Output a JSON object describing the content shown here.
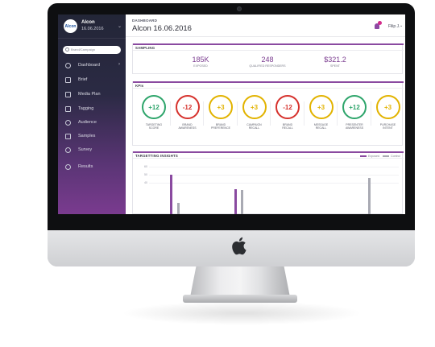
{
  "app": {
    "logo_text": "Alcon",
    "project_title": "Alcon",
    "project_date": "16.06.2016"
  },
  "sidebar": {
    "search_placeholder": "Brand/Campaign",
    "items": [
      {
        "label": "Dashboard",
        "icon": "dashboard-icon",
        "has_arrow": true
      },
      {
        "label": "Brief",
        "icon": "brief-icon"
      },
      {
        "label": "Media Plan",
        "icon": "media-plan-icon"
      },
      {
        "label": "Tagging",
        "icon": "tag-icon"
      },
      {
        "label": "Audience",
        "icon": "audience-icon"
      },
      {
        "label": "Samples",
        "icon": "samples-icon"
      },
      {
        "label": "Survey",
        "icon": "survey-icon"
      },
      {
        "label": "Results",
        "icon": "results-icon"
      }
    ]
  },
  "header": {
    "breadcrumb": "DASHBOARD",
    "title": "Alcon 16.06.2016",
    "user": "Filip J."
  },
  "sampling": {
    "title": "SAMPLING",
    "stats": [
      {
        "value": "185K",
        "label": "EXPOSED"
      },
      {
        "value": "248",
        "label": "QUALIFIED RESPONDERS"
      },
      {
        "value": "$321.2",
        "label": "SPENT"
      }
    ]
  },
  "kpis": {
    "title": "KPIs",
    "items": [
      {
        "value": "+12",
        "label_1": "TARGETING",
        "label_2": "SCORE",
        "color": "#2ea56b"
      },
      {
        "value": "-12",
        "label_1": "BRAND",
        "label_2": "AWARENESS",
        "color": "#d6322d"
      },
      {
        "value": "+3",
        "label_1": "BRAND",
        "label_2": "PREFERENCE",
        "color": "#e2b300"
      },
      {
        "value": "+3",
        "label_1": "CAMPAIGN",
        "label_2": "RECALL",
        "color": "#e2b300"
      },
      {
        "value": "-12",
        "label_1": "BRAND",
        "label_2": "RECALL",
        "color": "#d6322d"
      },
      {
        "value": "+3",
        "label_1": "MESSAGE",
        "label_2": "RECALL",
        "color": "#e2b300"
      },
      {
        "value": "+12",
        "label_1": "PRESENTER",
        "label_2": "AWARENESS",
        "color": "#2ea56b"
      },
      {
        "value": "+3",
        "label_1": "PURCHASE",
        "label_2": "INTENT",
        "color": "#e2b300"
      }
    ]
  },
  "insights": {
    "title": "TARGETTING INSIGHTS",
    "legend_exposed": "Exposed",
    "legend_control": "Control",
    "exposed_color": "#8a4aa0",
    "control_color": "#a9aab3"
  },
  "chart_data": {
    "type": "bar",
    "yticks": [
      "60",
      "50",
      "40"
    ],
    "ylim": [
      0,
      65
    ],
    "series": [
      {
        "name": "Exposed",
        "values": [
          50,
          32
        ]
      },
      {
        "name": "Control",
        "values": [
          14,
          30,
          46
        ]
      }
    ]
  }
}
